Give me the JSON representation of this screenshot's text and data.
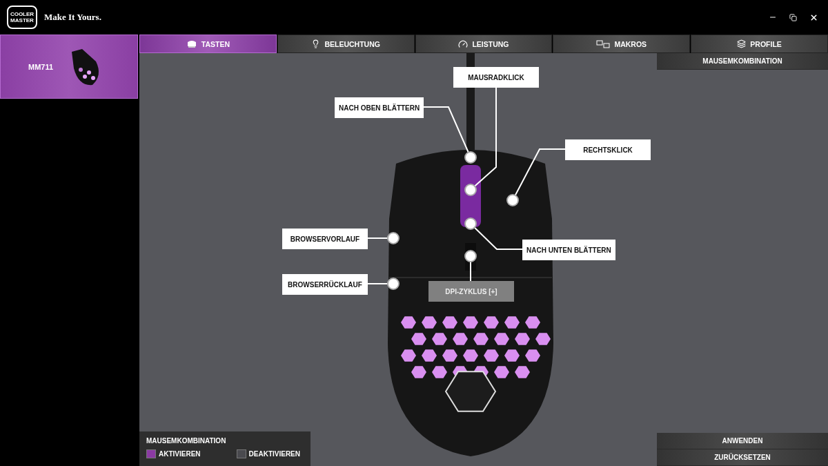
{
  "titlebar": {
    "logo_lines": [
      "COOLER",
      "MASTER"
    ],
    "tagline": "Make It Yours."
  },
  "devices": [
    {
      "name": "MM711",
      "selected": true
    }
  ],
  "tabs": [
    {
      "label": "TASTEN",
      "kind": "buttons",
      "selected": true
    },
    {
      "label": "BELEUCHTUNG",
      "kind": "lighting",
      "selected": false
    },
    {
      "label": "LEISTUNG",
      "kind": "performance",
      "selected": false
    },
    {
      "label": "MAKROS",
      "kind": "macros",
      "selected": false
    },
    {
      "label": "PROFILE",
      "kind": "profiles",
      "selected": false
    }
  ],
  "callouts": [
    {
      "label": "MAUSRADKLICK",
      "selected": false
    },
    {
      "label": "NACH OBEN BLÄTTERN",
      "selected": false
    },
    {
      "label": "RECHTSKLICK",
      "selected": false
    },
    {
      "label": "BROWSERVORLAUF",
      "selected": false
    },
    {
      "label": "NACH UNTEN BLÄTTERN",
      "selected": false
    },
    {
      "label": "BROWSERRÜCKLAUF",
      "selected": false
    },
    {
      "label": "DPI-ZYKLUS [+]",
      "selected": true
    }
  ],
  "combo_panel": {
    "title": "MAUSEMKOMBINATION",
    "options": [
      {
        "label": "AKTIVIEREN",
        "selected": true
      },
      {
        "label": "DEAKTIVIEREN",
        "selected": false
      }
    ]
  },
  "right_panel": {
    "header": "MAUSEMKOMBINATION",
    "buttons": [
      "ANWENDEN",
      "ZURÜCKSETZEN"
    ]
  }
}
